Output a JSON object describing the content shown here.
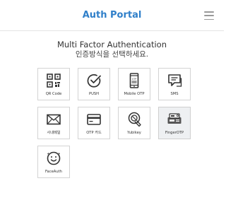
{
  "header": {
    "title": "Auth Portal",
    "menu_icon": "hamburger-menu-icon"
  },
  "heading": "Multi Factor Authentication",
  "subheading": "인증방식을 선택하세요.",
  "methods": [
    {
      "label": "QR Code",
      "icon": "qr-code-icon"
    },
    {
      "label": "PUSH",
      "icon": "check-circle-icon"
    },
    {
      "label": "Mobile OTP",
      "icon": "mobile-phone-icon"
    },
    {
      "label": "SMS",
      "icon": "chat-bubble-icon"
    },
    {
      "label": "사내메일",
      "icon": "envelope-icon"
    },
    {
      "label": "OTP 카드",
      "icon": "credit-card-icon"
    },
    {
      "label": "Yubikey",
      "icon": "yubikey-icon"
    },
    {
      "label": "FingerOTP",
      "icon": "finger-otp-icon",
      "selected": true
    },
    {
      "label": "FaceAuth",
      "icon": "face-icon"
    }
  ],
  "colors": {
    "title": "#2f7fc9",
    "tile_border": "#d3d3d3",
    "icon": "#333333",
    "selected_bg": "#eef0f2"
  }
}
